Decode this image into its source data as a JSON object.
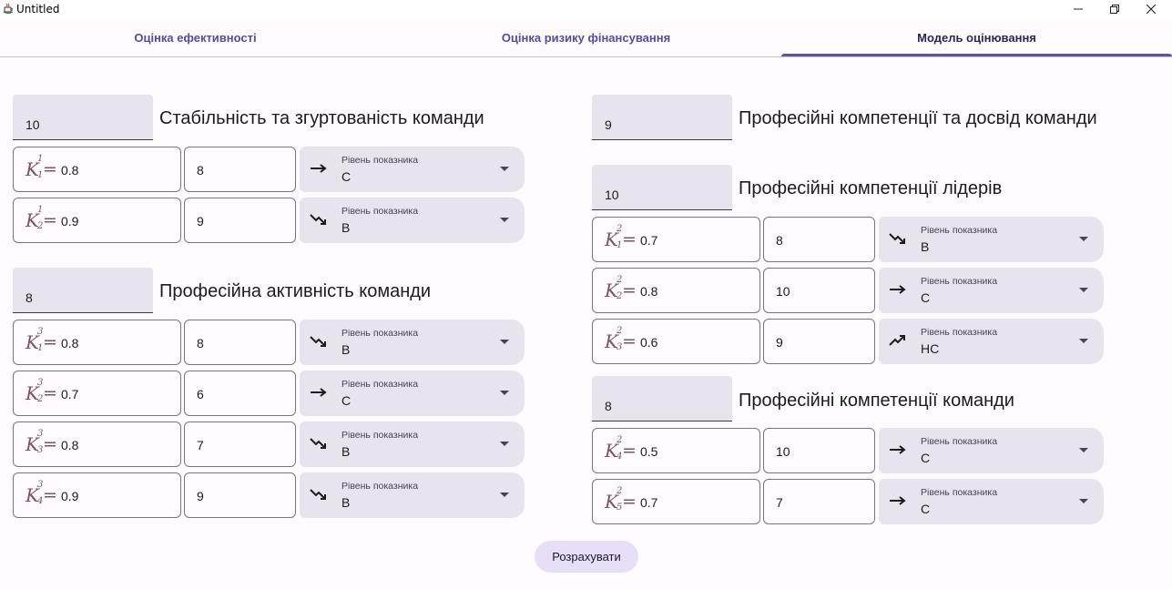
{
  "window": {
    "title": "Untitled"
  },
  "tabs": [
    {
      "label": "Оцінка ефективності"
    },
    {
      "label": "Оцінка ризику фінансування"
    },
    {
      "label": "Модель оцінювання"
    }
  ],
  "level_label": "Рівень показника",
  "groups": [
    {
      "score": "10",
      "title": "Стабільність та згуртованість команди",
      "rows": [
        {
          "k_sup": "1",
          "k_sub": "1",
          "k_value": "0.8",
          "value": "8",
          "trend_icon": "arrow-right-icon",
          "level": "C"
        },
        {
          "k_sup": "1",
          "k_sub": "2",
          "k_value": "0.9",
          "value": "9",
          "trend_icon": "trending-down-icon",
          "level": "B"
        }
      ]
    },
    {
      "score": "8",
      "title": "Професійна активність команди",
      "rows": [
        {
          "k_sup": "3",
          "k_sub": "1",
          "k_value": "0.8",
          "value": "8",
          "trend_icon": "trending-down-icon",
          "level": "B"
        },
        {
          "k_sup": "3",
          "k_sub": "2",
          "k_value": "0.7",
          "value": "6",
          "trend_icon": "arrow-right-icon",
          "level": "C"
        },
        {
          "k_sup": "3",
          "k_sub": "3",
          "k_value": "0.8",
          "value": "7",
          "trend_icon": "trending-down-icon",
          "level": "B"
        },
        {
          "k_sup": "3",
          "k_sub": "4",
          "k_value": "0.9",
          "value": "9",
          "trend_icon": "trending-down-icon",
          "level": "B"
        }
      ]
    },
    {
      "score": "9",
      "title": "Професійні компетенції та досвід команди",
      "rows": []
    },
    {
      "score": "10",
      "title": "Професійні компетенції лідерів",
      "rows": [
        {
          "k_sup": "2",
          "k_sub": "1",
          "k_value": "0.7",
          "value": "8",
          "trend_icon": "trending-down-icon",
          "level": "B"
        },
        {
          "k_sup": "2",
          "k_sub": "2",
          "k_value": "0.8",
          "value": "10",
          "trend_icon": "arrow-right-icon",
          "level": "C"
        },
        {
          "k_sup": "2",
          "k_sub": "3",
          "k_value": "0.6",
          "value": "9",
          "trend_icon": "trending-up-icon",
          "level": "HC"
        }
      ]
    },
    {
      "score": "8",
      "title": "Професійні компетенції команди",
      "rows": [
        {
          "k_sup": "2",
          "k_sub": "4",
          "k_value": "0.5",
          "value": "10",
          "trend_icon": "arrow-right-icon",
          "level": "C"
        },
        {
          "k_sup": "2",
          "k_sub": "5",
          "k_value": "0.7",
          "value": "7",
          "trend_icon": "arrow-right-icon",
          "level": "C"
        }
      ]
    }
  ],
  "calculate_button": "Розрахувати",
  "colors": {
    "accent": "#6750a4",
    "field_fill": "#e8e3ed",
    "button_fill": "#e8def8"
  }
}
